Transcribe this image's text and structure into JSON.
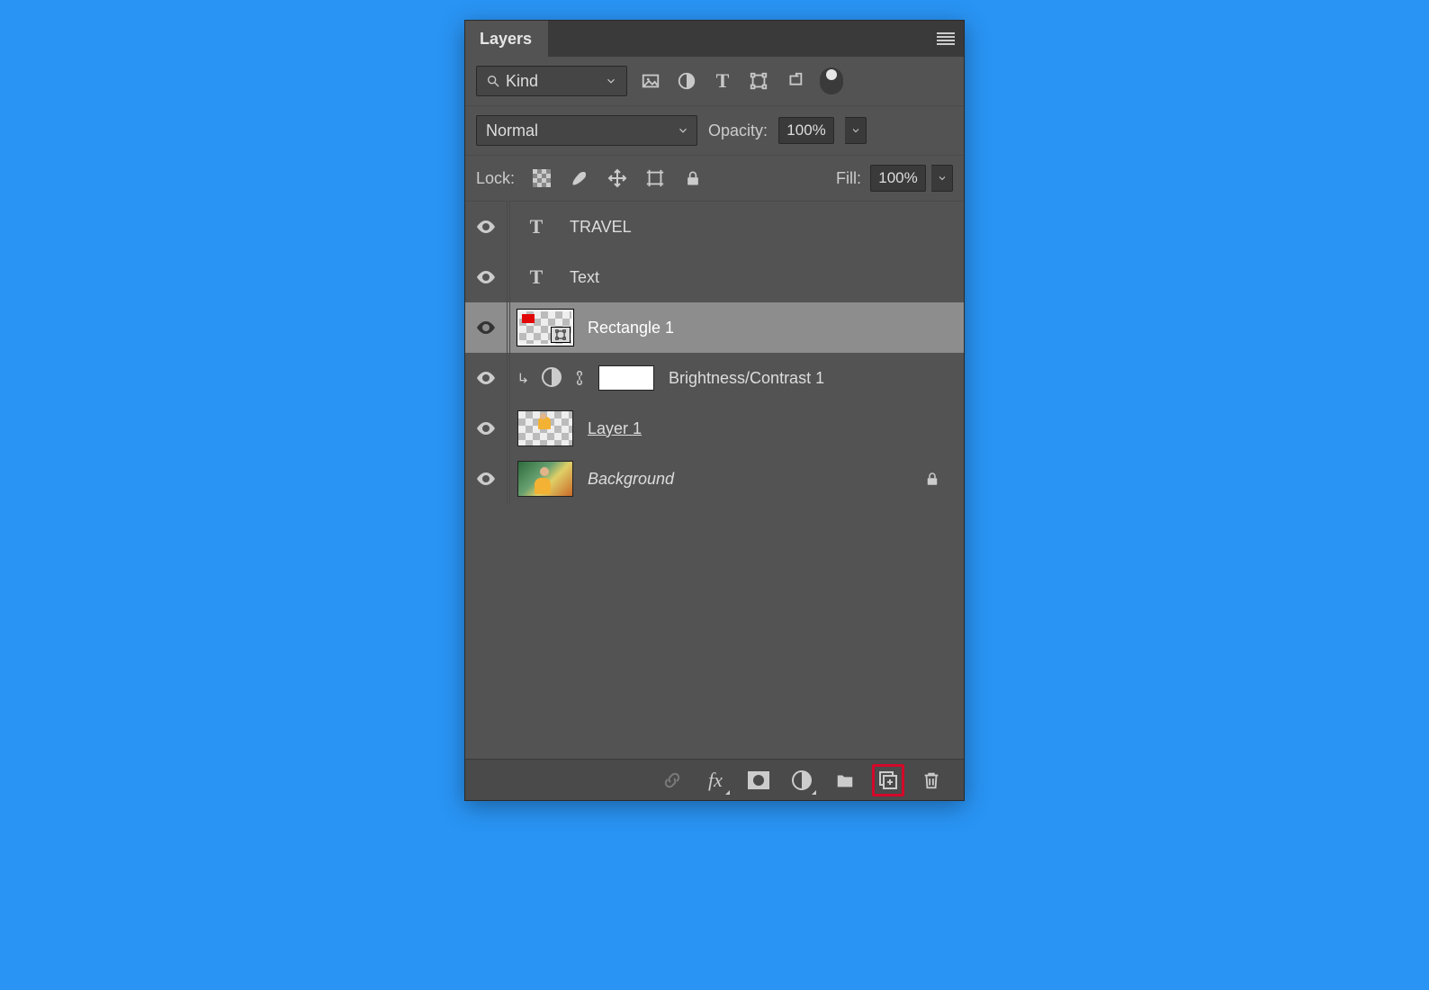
{
  "tab_title": "Layers",
  "filter": {
    "kind_label": "Kind"
  },
  "blend_mode": "Normal",
  "opacity": {
    "label": "Opacity:",
    "value": "100%"
  },
  "lock": {
    "label": "Lock:"
  },
  "fill": {
    "label": "Fill:",
    "value": "100%"
  },
  "layers": [
    {
      "name": "TRAVEL",
      "kind": "text"
    },
    {
      "name": "Text",
      "kind": "text"
    },
    {
      "name": "Rectangle 1",
      "kind": "shape",
      "selected": true
    },
    {
      "name": "Brightness/Contrast 1",
      "kind": "adjustment",
      "clipped": true
    },
    {
      "name": "Layer 1",
      "kind": "pixel",
      "underline": true
    },
    {
      "name": "Background",
      "kind": "bg",
      "locked": true,
      "italic": true
    }
  ]
}
